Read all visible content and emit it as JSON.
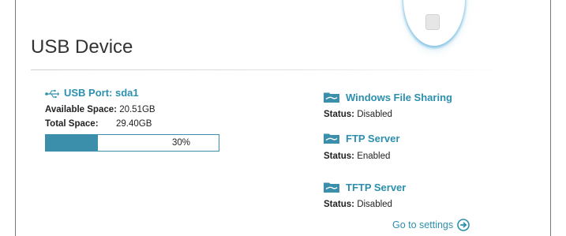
{
  "page": {
    "title": "USB Device"
  },
  "usb": {
    "port_label": "USB Port: sda1",
    "available_label": "Available Space:",
    "available_value": "20.51GB",
    "total_label": "Total Space:",
    "total_value": "29.40GB",
    "usage_percent_text": "30%",
    "usage_fraction": 0.3
  },
  "sharing": [
    {
      "title": "Windows File Sharing",
      "status_label": "Status:",
      "status_value": "Disabled"
    },
    {
      "title": "FTP Server",
      "status_label": "Status:",
      "status_value": "Enabled"
    },
    {
      "title": "TFTP Server",
      "status_label": "Status:",
      "status_value": "Disabled"
    }
  ],
  "goto_settings": {
    "label": "Go to settings",
    "icon": "arrow-right-circle-icon"
  },
  "icons": {
    "usb": "usb-icon",
    "folder": "folder-icon",
    "device": "usb-device-icon"
  },
  "colors": {
    "accent": "#2c8fad",
    "bar": "#3b8fab",
    "frame": "#7a7a7a"
  }
}
